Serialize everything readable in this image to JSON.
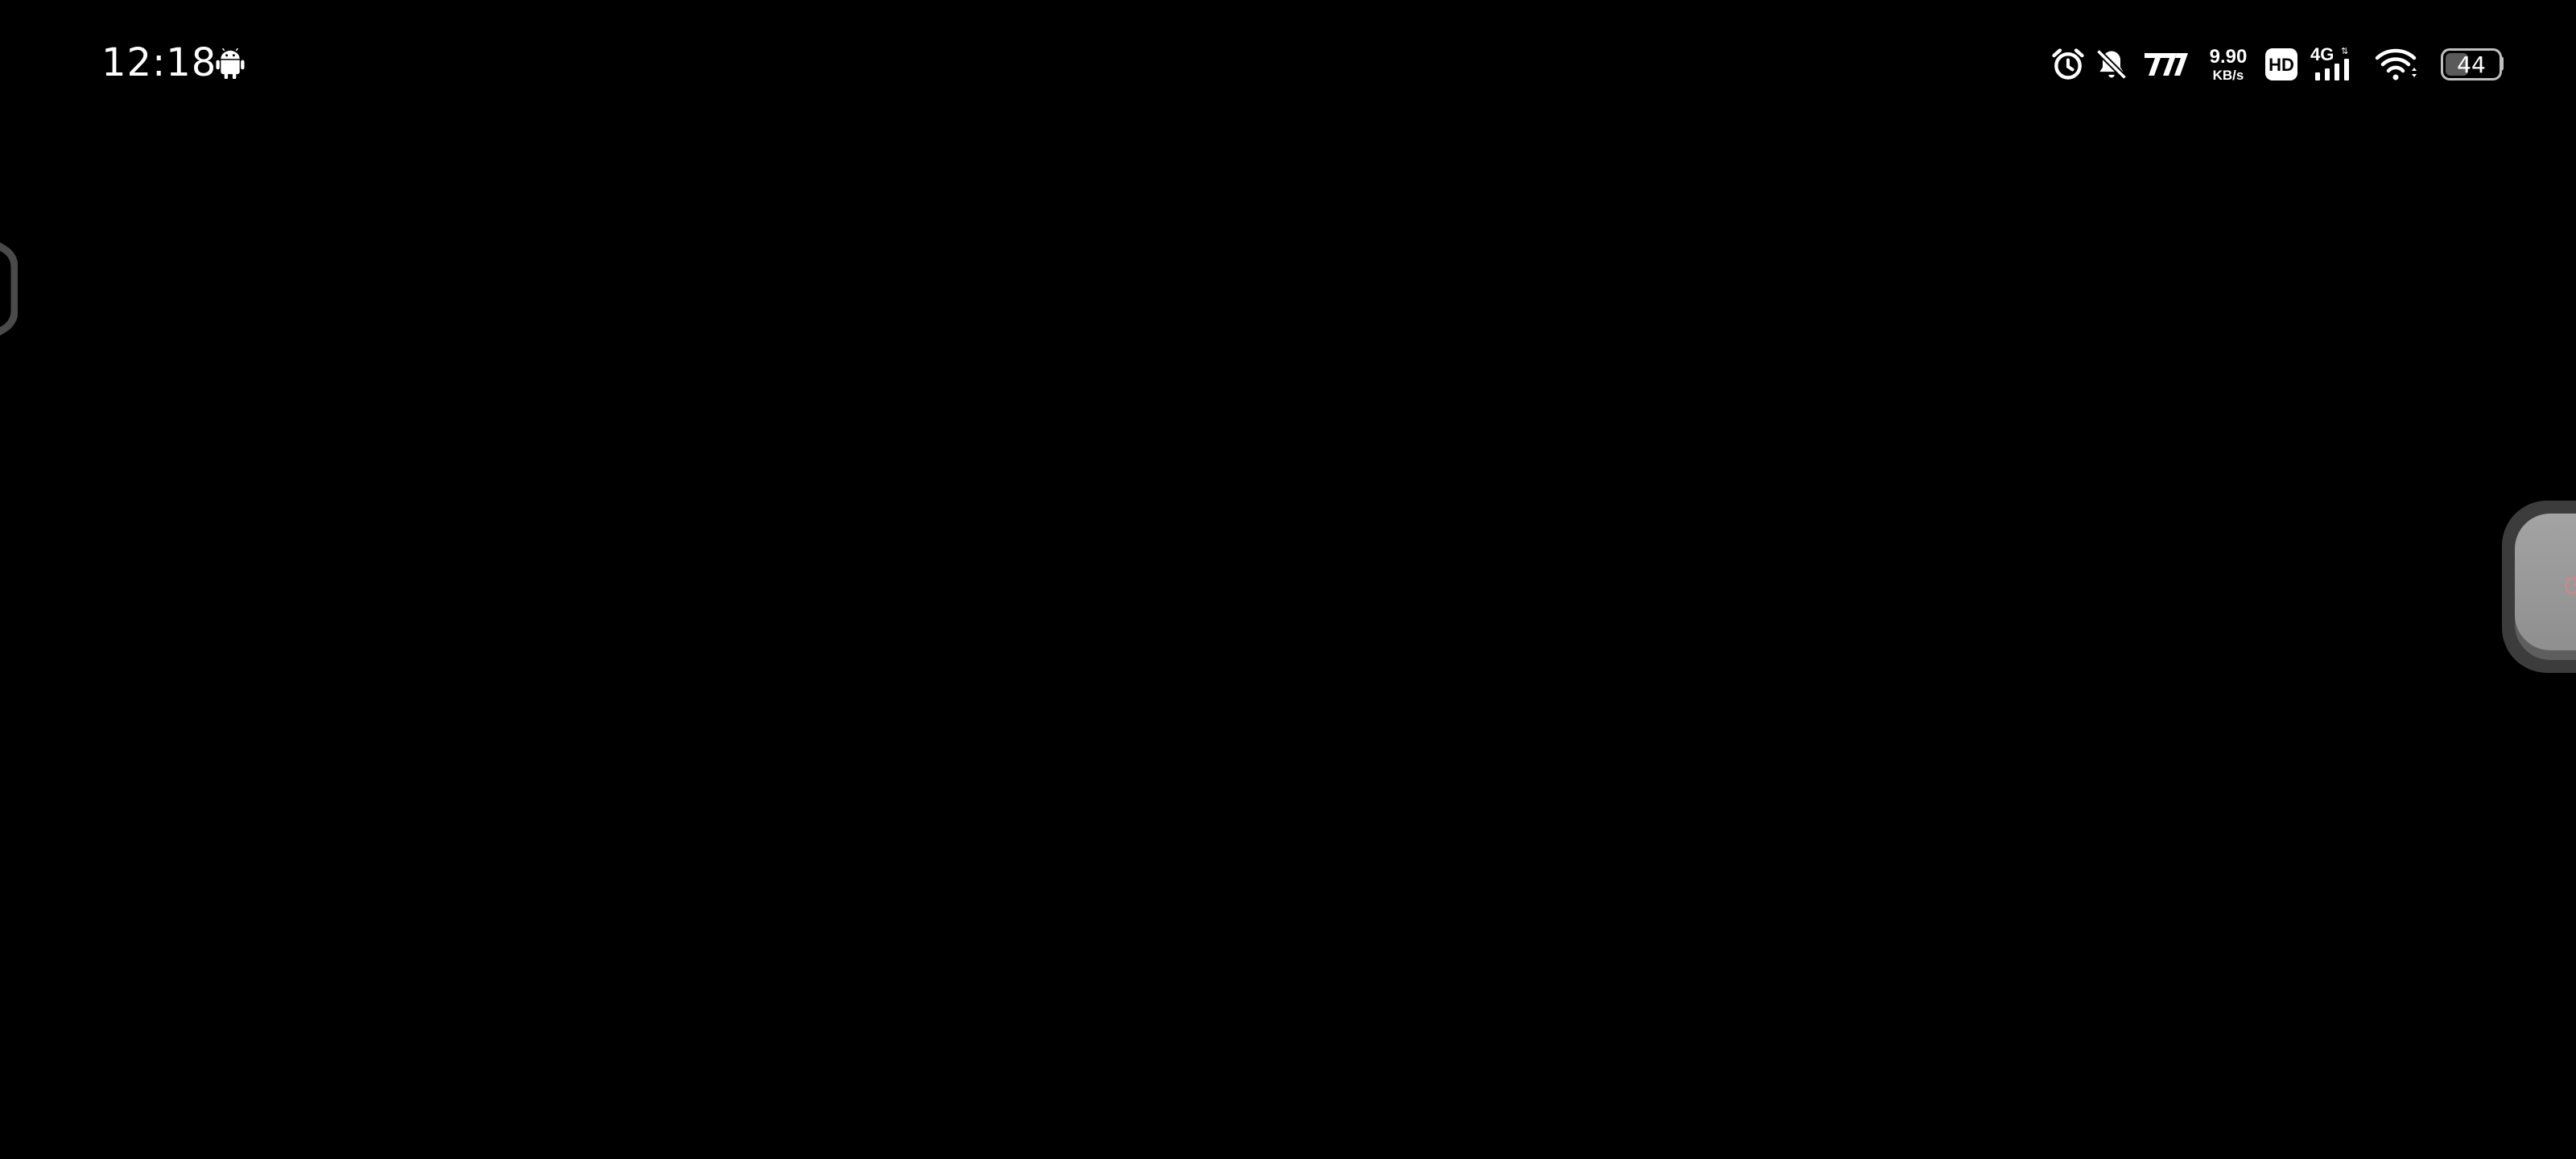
{
  "status_bar": {
    "time": "12:18",
    "network_speed": {
      "value": "9.90",
      "unit": "KB/s"
    },
    "hd_label": "HD",
    "network_type": "4G",
    "battery_level": "44",
    "battery_percent": 44,
    "icons": [
      "android-icon",
      "alarm-icon",
      "bell-off-icon",
      "carrier-icon",
      "hd-icon",
      "signal-icon",
      "wifi-icon",
      "battery-icon"
    ]
  },
  "colors": {
    "background": "#000000",
    "status_text": "#ffffff",
    "floating_ball": "#9a9a9a",
    "edge_handle": "#4a4a4a"
  }
}
